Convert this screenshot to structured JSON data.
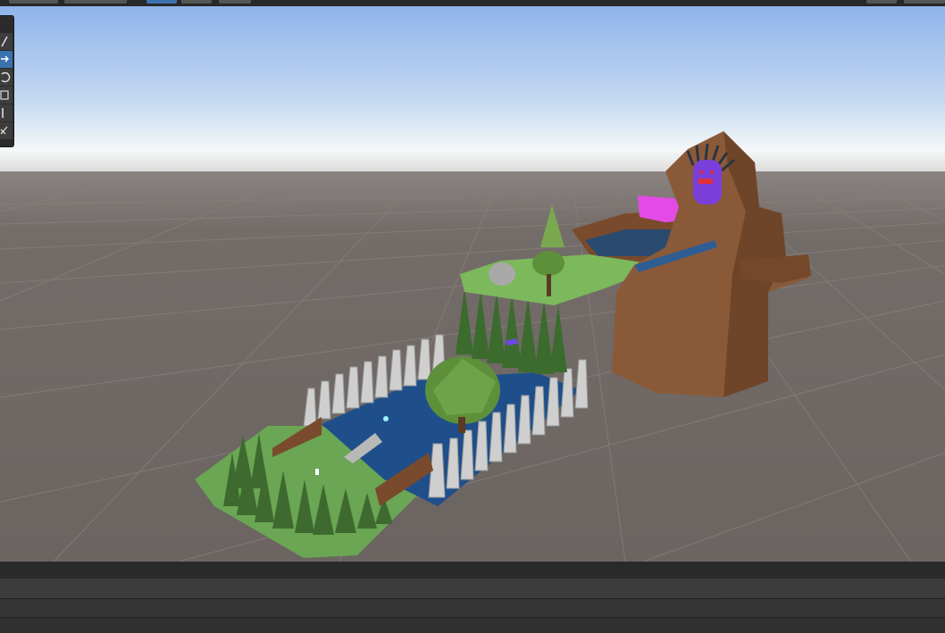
{
  "toolbar": {
    "buttons": [
      "play-controls",
      "layers",
      "layout"
    ]
  },
  "scene_tools": {
    "items": [
      {
        "name": "view-tool",
        "icon": "hand-icon",
        "active": false
      },
      {
        "name": "move-tool",
        "icon": "move-arrows-icon",
        "active": true
      },
      {
        "name": "rotate-tool",
        "icon": "rotate-icon",
        "active": false
      },
      {
        "name": "scale-tool",
        "icon": "scale-icon",
        "active": false
      },
      {
        "name": "rect-tool",
        "icon": "rect-transform-icon",
        "active": false
      },
      {
        "name": "transform-tool",
        "icon": "transform-icon",
        "active": false
      }
    ]
  },
  "scene": {
    "sky_top": "#8fb3ea",
    "horizon": "#f5f7f8",
    "ground": "#6e6764",
    "grid_line": "#857e7a",
    "grass": "#6aa653",
    "water": "#1e4f87",
    "rock_mountain": "#8a5a38",
    "character": "#7b3fd9",
    "highlight_magenta": "#e44be6"
  },
  "console": {
    "search_icon": "search-icon",
    "search_placeholder": ""
  }
}
